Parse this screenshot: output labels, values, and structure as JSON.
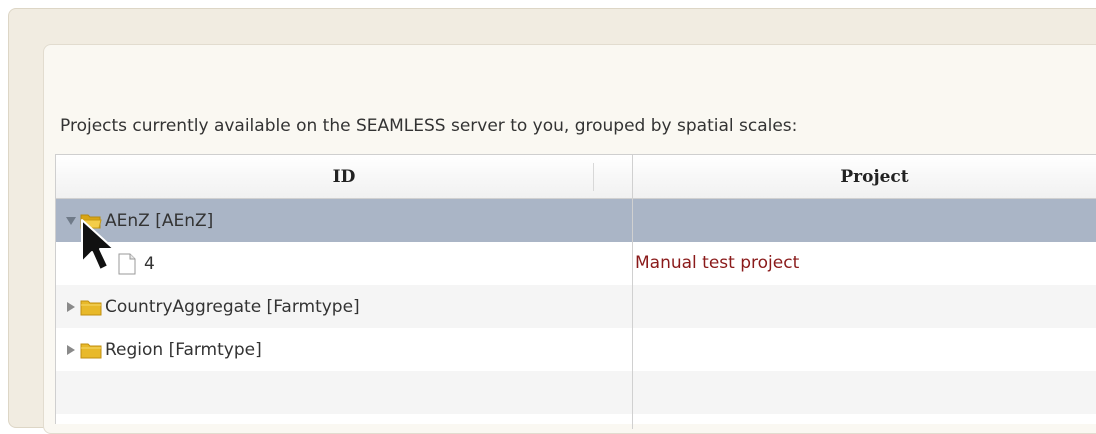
{
  "caption": "Projects currently available on the SEAMLESS server to you, grouped by spatial scales:",
  "grid": {
    "columns": [
      "ID",
      "Project"
    ],
    "rows": [
      {
        "label": "AEnZ [AEnZ]",
        "project": "",
        "expanded": true,
        "selected": true,
        "icon": "folder-open-icon"
      },
      {
        "label": "4",
        "project": "Manual test project",
        "leaf": true,
        "icon": "document-icon"
      },
      {
        "label": "CountryAggregate [Farmtype]",
        "project": "",
        "expanded": false,
        "icon": "folder-icon"
      },
      {
        "label": "Region [Farmtype]",
        "project": "",
        "expanded": false,
        "icon": "folder-icon"
      }
    ]
  },
  "colors": {
    "selected_row": "#aab5c6",
    "alt_row": "#f5f5f5",
    "project_text": "#8a1a1a",
    "folder": "#e8b92a"
  }
}
